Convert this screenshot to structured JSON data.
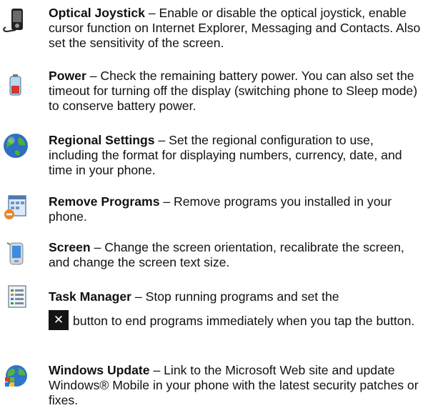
{
  "items": [
    {
      "name": "Optical Joystick",
      "sep": " – ",
      "desc": "Enable or disable the optical joystick, enable cursor function on Internet Explorer, Messaging and Contacts. Also set the sensitivity of the screen.",
      "icon": "optical-joystick-icon"
    },
    {
      "name": "Power",
      "sep": " – ",
      "desc": "Check the remaining battery power. You can also set the timeout for turning off the display (switching phone to Sleep mode) to conserve battery power.",
      "icon": "battery-icon"
    },
    {
      "name": "Regional Settings",
      "sep": " – ",
      "desc": "Set the regional configuration to use, including the format for displaying numbers, currency, date, and time in your phone.",
      "icon": "globe-icon"
    },
    {
      "name": "Remove Programs",
      "sep": " – ",
      "desc": "Remove programs you installed in your phone.",
      "icon": "remove-programs-icon"
    },
    {
      "name": "Screen",
      "sep": " – ",
      "desc": "Change the screen orientation, recalibrate the screen, and change the screen text size.",
      "icon": "screen-icon"
    },
    {
      "name": "Task Manager",
      "sep": " – ",
      "desc_part1": "Stop running programs and set the",
      "desc_part2": "button to end programs immediately when you tap the button.",
      "button_glyph": "✕",
      "icon": "task-manager-icon"
    },
    {
      "name": "Windows Update",
      "sep": " – ",
      "desc": "Link to the Microsoft Web site and update Windows® Mobile in your phone with the latest security patches or fixes.",
      "icon": "windows-update-icon"
    }
  ]
}
